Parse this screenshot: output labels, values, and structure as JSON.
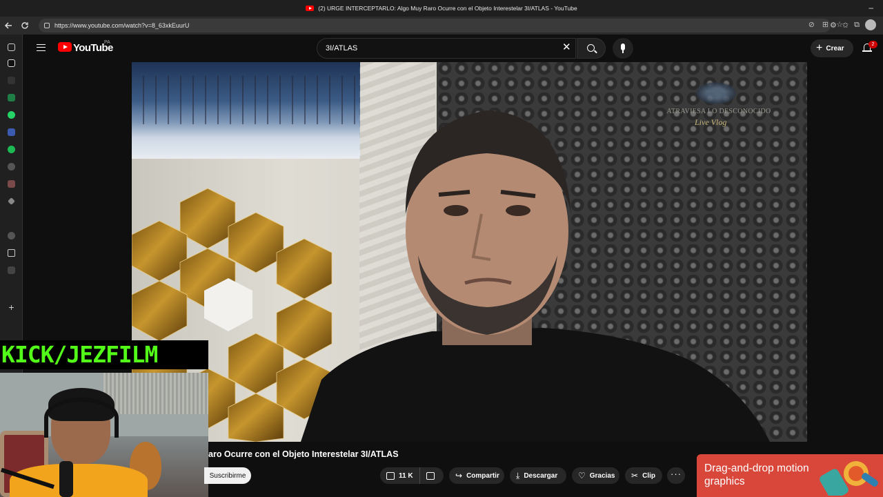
{
  "browser": {
    "window_title": "(2) URGE INTERCEPTARLO: Algo Muy Raro Ocurre con el Objeto Interestelar 3I/ATLAS - YouTube",
    "url": "https://www.youtube.com/watch?v=8_63xkEuurU",
    "minimize_glyph": "–"
  },
  "youtube": {
    "logo_text": "YouTube",
    "country_code": "PA",
    "search_value": "3I/ATLAS",
    "create_label": "Crear",
    "notification_count": "2"
  },
  "video": {
    "watermark_line1": "ATRAVIESA LO DESCONOCIDO",
    "watermark_line2": "Live Vlog",
    "title_visible": "aro Ocurre con el Objeto Interestelar 3I/ATLAS"
  },
  "overlay": {
    "kick_text": "KICK/JEZFILM"
  },
  "actions": {
    "subscribe_label": "Suscribirme",
    "like_count": "11 K",
    "share_label": "Compartir",
    "download_label": "Descargar",
    "thanks_label": "Gracias",
    "clip_label": "Clip"
  },
  "ad": {
    "text": "Drag-and-drop motion graphics",
    "color": "#d9463a"
  },
  "colors": {
    "kick_green": "#53fc18",
    "youtube_red": "#ff0000"
  }
}
